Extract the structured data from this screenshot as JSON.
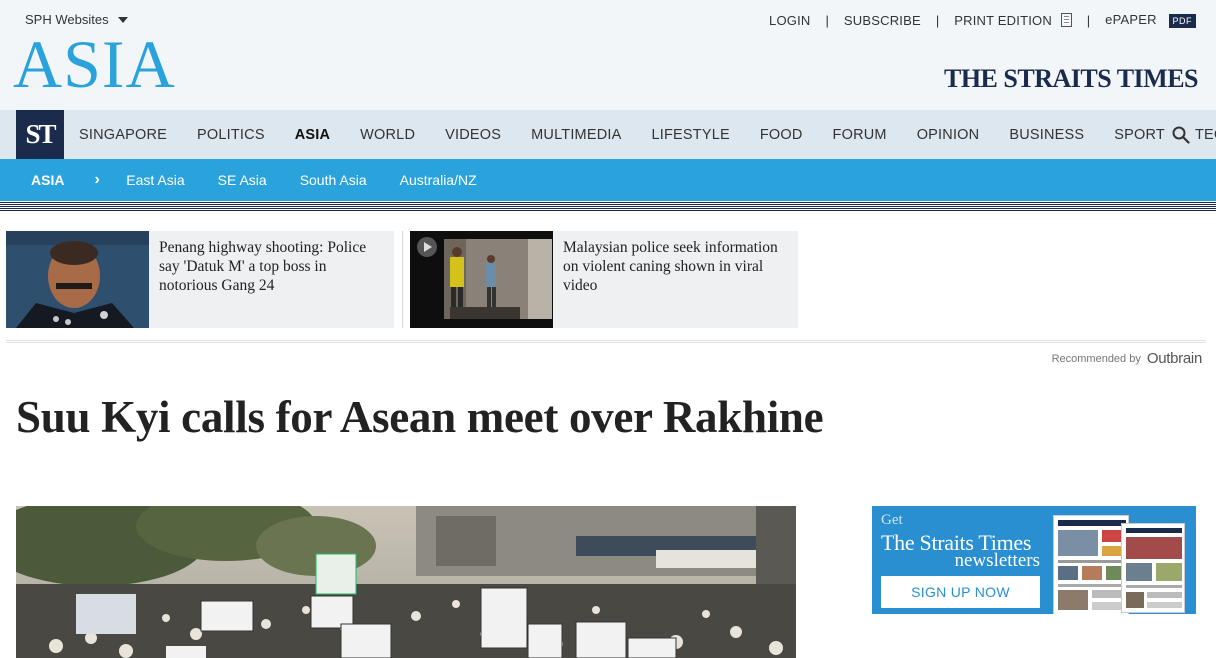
{
  "header": {
    "sph_label": "SPH Websites",
    "section_logo": "ASIA",
    "masthead": "THE STRAITS TIMES",
    "links": {
      "login": "LOGIN",
      "subscribe": "SUBSCRIBE",
      "print_edition": "PRINT EDITION",
      "epaper": "ePAPER",
      "pdf_badge": "PDF",
      "separator": "|"
    }
  },
  "nav": {
    "logo": "ST",
    "items": [
      "SINGAPORE",
      "POLITICS",
      "ASIA",
      "WORLD",
      "VIDEOS",
      "MULTIMEDIA",
      "LIFESTYLE",
      "FOOD",
      "FORUM",
      "OPINION",
      "BUSINESS",
      "SPORT",
      "TECH"
    ],
    "active": "ASIA"
  },
  "subnav": {
    "current": "ASIA",
    "chevron": "›",
    "items": [
      "East Asia",
      "SE Asia",
      "South Asia",
      "Australia/NZ"
    ]
  },
  "recommended": {
    "cards": [
      {
        "title": "Penang highway shooting: Police say 'Datuk M' a top boss in notorious Gang 24"
      },
      {
        "title": "Malaysian police seek information on violent caning shown in viral video"
      }
    ],
    "credit_label": "Recommended by",
    "credit_brand": "Outbrain"
  },
  "article": {
    "headline": "Suu Kyi calls for Asean meet over Rakhine"
  },
  "ad": {
    "get": "Get",
    "brand": "The Straits Times",
    "product": "newsletters",
    "button": "SIGN UP NOW"
  },
  "colors": {
    "accent_blue": "#2aa3dc",
    "navy": "#1a2b4c",
    "nav_bg": "#dde7ef"
  }
}
